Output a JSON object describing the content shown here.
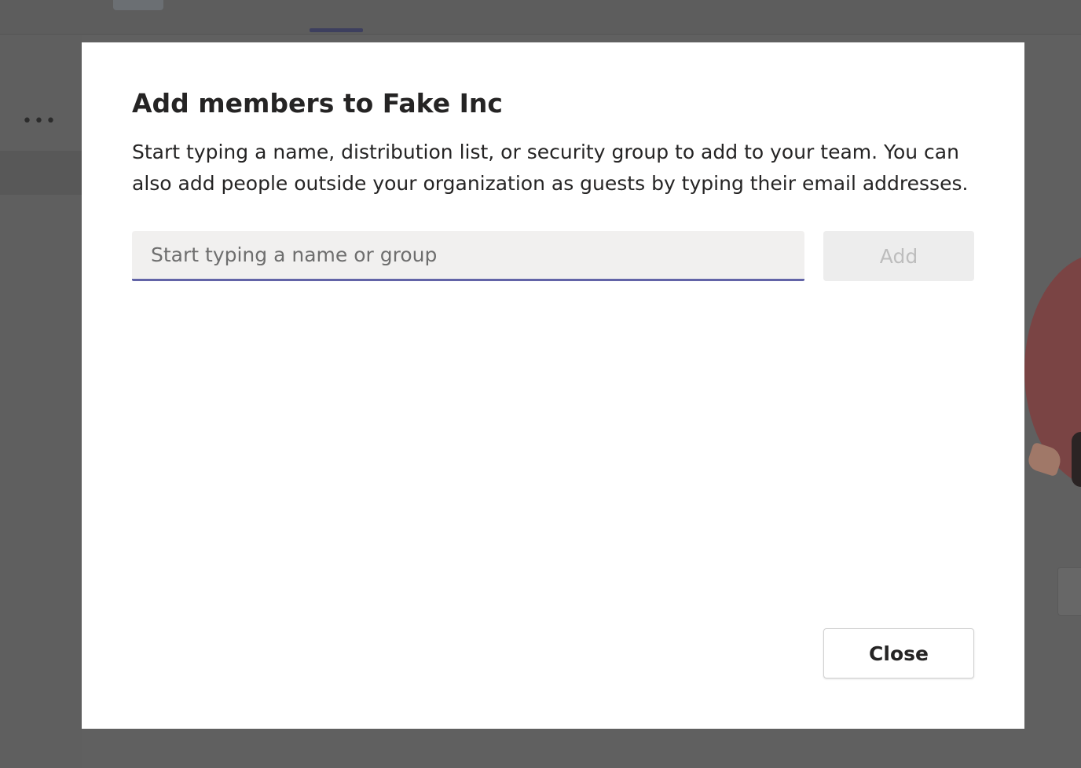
{
  "background": {
    "more_icon": "more-horizontal-icon",
    "more_glyph": "•••"
  },
  "dialog": {
    "title": "Add members to Fake Inc",
    "description": "Start typing a name, distribution list, or security group to add to your team. You can also add people outside your organization as guests by typing their email addresses.",
    "search": {
      "value": "",
      "placeholder": "Start typing a name or group"
    },
    "add_label": "Add",
    "add_enabled": false,
    "close_label": "Close"
  },
  "colors": {
    "accent": "#6264a7",
    "title_text": "#252424",
    "input_background": "#f1f0ef",
    "disabled_button": "#ededed",
    "disabled_text": "#bdbdbd",
    "overlay": "#606060"
  }
}
